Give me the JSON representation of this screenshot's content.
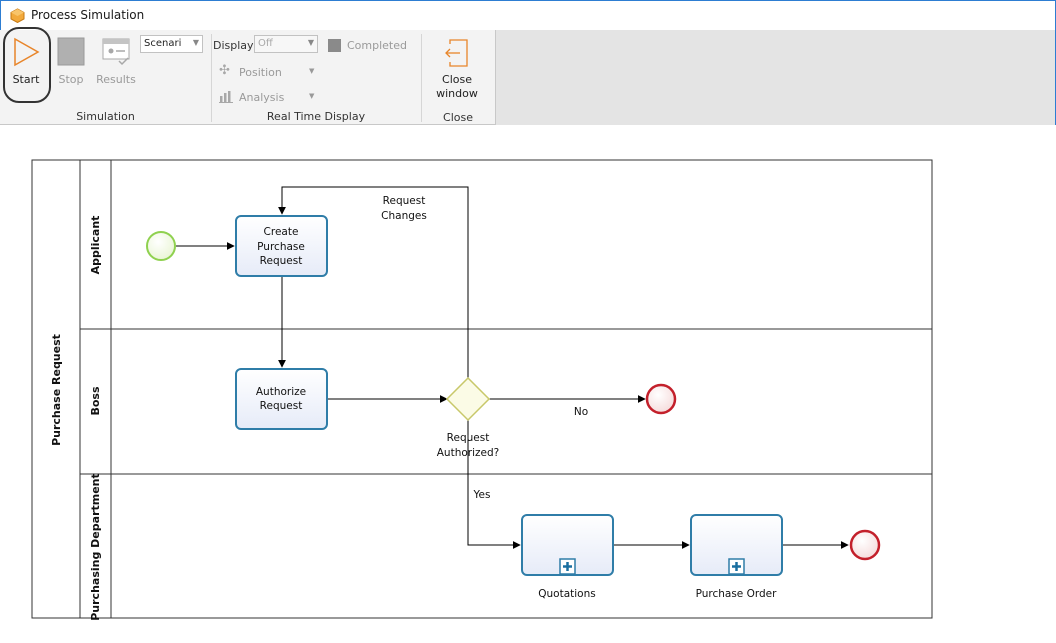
{
  "window": {
    "title": "Process Simulation"
  },
  "ribbon": {
    "simulation": {
      "group_label": "Simulation",
      "start_label": "Start",
      "stop_label": "Stop",
      "results_label": "Results",
      "scenario_value": "Scenari"
    },
    "realtime": {
      "group_label": "Real Time Display",
      "display_label": "Display",
      "display_value": "Off",
      "completed_label": "Completed",
      "position_label": "Position",
      "analysis_label": "Analysis"
    },
    "close": {
      "group_label": "Close",
      "close_line1": "Close",
      "close_line2": "window"
    }
  },
  "diagram": {
    "pool_name": "Purchase Request",
    "lanes": [
      "Applicant",
      "Boss",
      "Purchasing Department"
    ],
    "tasks": {
      "create": [
        "Create",
        "Purchase",
        "Request"
      ],
      "authorize": [
        "Authorize",
        "Request"
      ],
      "quotations": "Quotations",
      "purchase_order": "Purchase Order"
    },
    "gateway_label": [
      "Request",
      "Authorized?"
    ],
    "flow_labels": {
      "changes": [
        "Request",
        "Changes"
      ],
      "no": "No",
      "yes": "Yes"
    }
  },
  "colors": {
    "start_event": "#8fd14f",
    "end_event": "#c3202b",
    "task_border": "#2f7da8",
    "gateway": "#d9d96a",
    "title_border": "#2d7dd2"
  }
}
